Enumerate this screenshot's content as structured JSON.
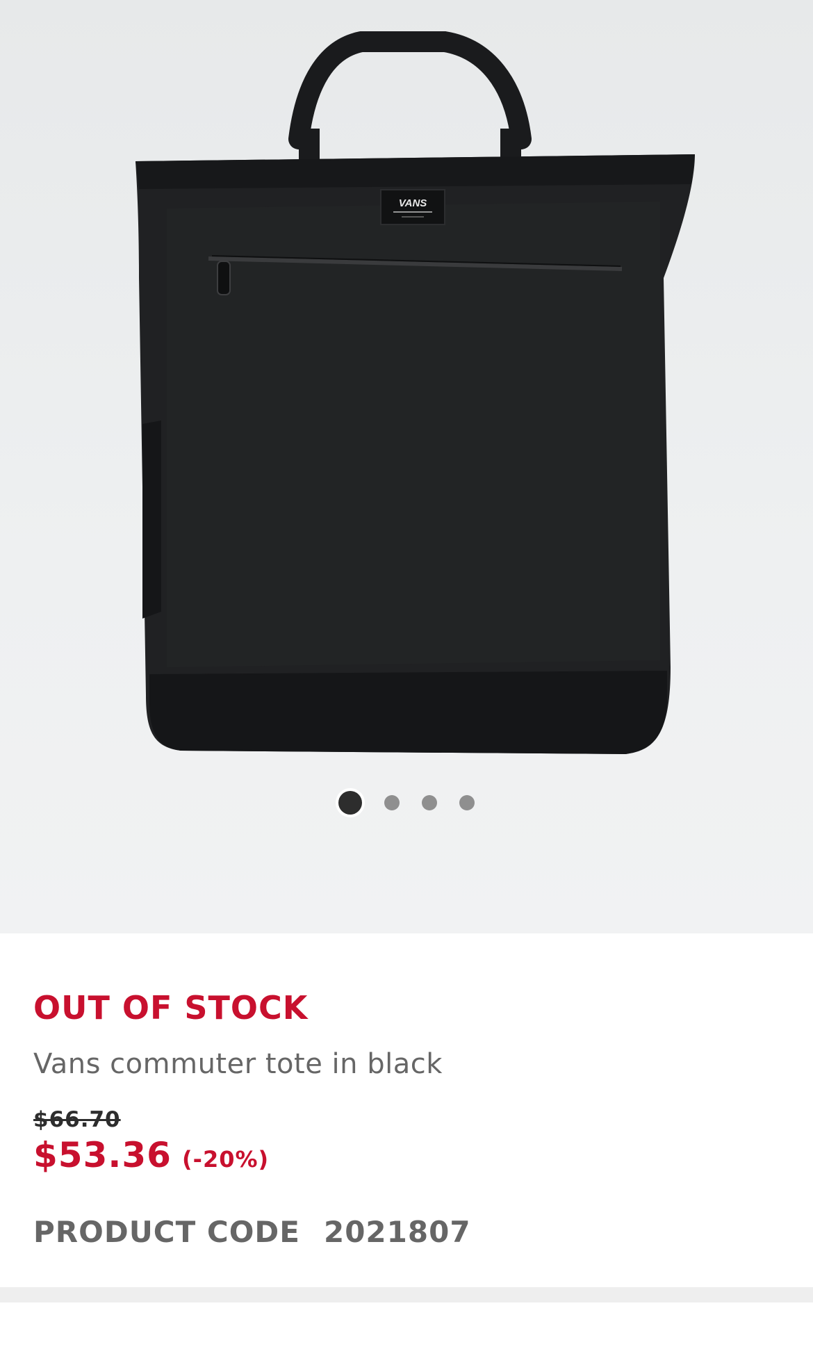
{
  "gallery": {
    "brand_label": "VANS",
    "slide_count": 4,
    "active_slide": 1,
    "dots": [
      "Slide 1",
      "Slide 2",
      "Slide 3",
      "Slide 4"
    ]
  },
  "product": {
    "stock_status": "OUT OF STOCK",
    "title": "Vans commuter tote in black",
    "original_price": "$66.70",
    "sale_price": "$53.36",
    "discount": "(-20%)",
    "code_label": "PRODUCT CODE",
    "code_value": "2021807"
  },
  "colors": {
    "accent": "#c8102e",
    "text_gray": "#666666",
    "dark": "#2d2d2d",
    "hero_bg": "#eceeef"
  }
}
